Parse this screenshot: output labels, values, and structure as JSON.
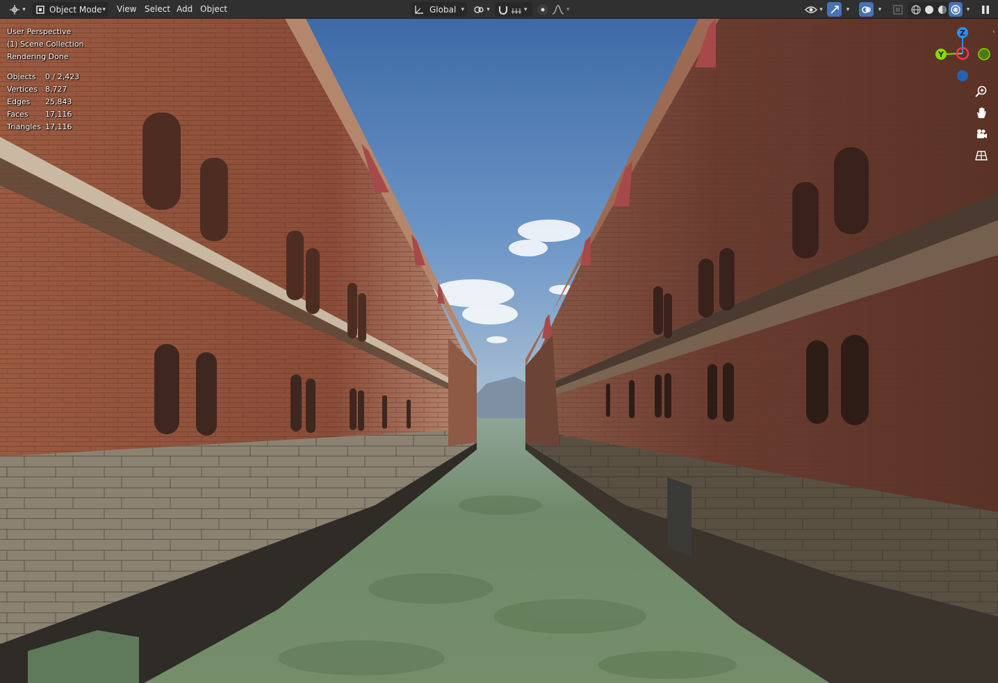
{
  "header": {
    "mode_label": "Object Mode",
    "menus": [
      "View",
      "Select",
      "Add",
      "Object"
    ],
    "orientation_label": "Global"
  },
  "overlay": {
    "perspective": "User Perspective",
    "collection": "(1) Scene Collection",
    "status": "Rendering Done",
    "stats": [
      {
        "label": "Objects",
        "value": "0 / 2,423"
      },
      {
        "label": "Vertices",
        "value": "8,727"
      },
      {
        "label": "Edges",
        "value": "25,843"
      },
      {
        "label": "Faces",
        "value": "17,116"
      },
      {
        "label": "Triangles",
        "value": "17,116"
      }
    ]
  },
  "gizmo": {
    "x_label": "X",
    "y_label": "Y",
    "z_label": "Z"
  },
  "colors": {
    "header_bg": "#303030",
    "accent": "#4772b3",
    "axis_x": "#ff3352",
    "axis_y": "#8bdc00",
    "axis_z": "#2890ff"
  },
  "icons": {
    "editor_type": "view3d-icon",
    "mode": "object-mode-icon",
    "orientation": "transform-orientation-icon",
    "pivot": "pivot-point-icon",
    "snap": "snap-icon",
    "proportional": "proportional-editing-icon",
    "visibility": "eye-icon",
    "gizmos": "gizmo-icon",
    "overlays": "overlay-icon",
    "xray": "xray-icon",
    "shading": [
      "wireframe-icon",
      "solid-icon",
      "material-preview-icon",
      "rendered-icon"
    ],
    "zoom": "zoom-icon",
    "pan": "hand-icon",
    "camera": "camera-icon",
    "ortho": "grid-icon"
  }
}
